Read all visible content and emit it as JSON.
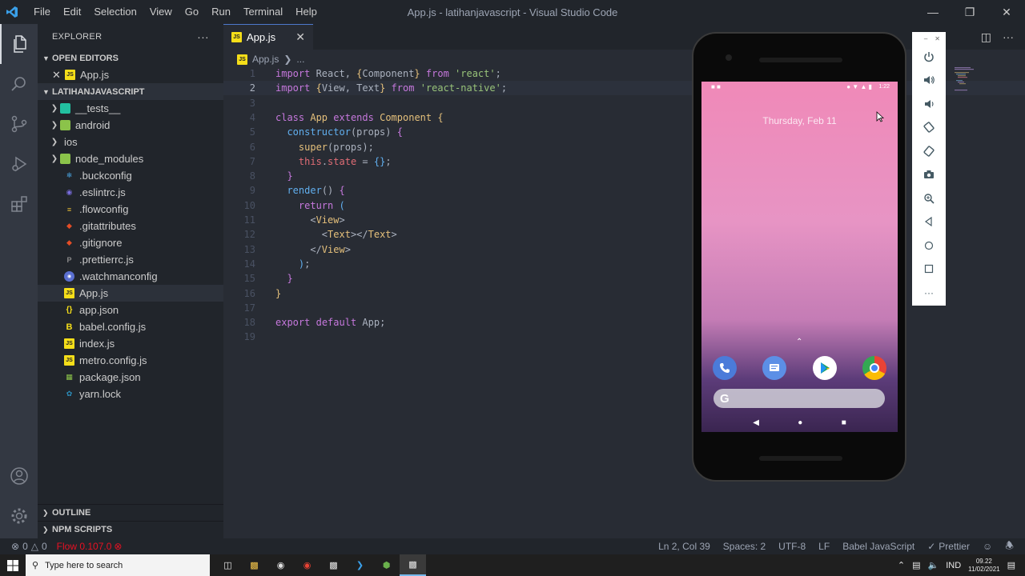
{
  "window": {
    "title": "App.js - latihanjavascript - Visual Studio Code",
    "menu": [
      "File",
      "Edit",
      "Selection",
      "View",
      "Go",
      "Run",
      "Terminal",
      "Help"
    ]
  },
  "sidebar": {
    "explorer_label": "EXPLORER",
    "open_editors_label": "OPEN EDITORS",
    "open_editor_item": "App.js",
    "project_label": "LATIHANJAVASCRIPT",
    "folders": [
      "__tests__",
      "android",
      "ios",
      "node_modules"
    ],
    "files": [
      ".buckconfig",
      ".eslintrc.js",
      ".flowconfig",
      ".gitattributes",
      ".gitignore",
      ".prettierrc.js",
      ".watchmanconfig",
      "App.js",
      "app.json",
      "babel.config.js",
      "index.js",
      "metro.config.js",
      "package.json",
      "yarn.lock"
    ],
    "outline_label": "OUTLINE",
    "npm_label": "NPM SCRIPTS"
  },
  "tab": {
    "label": "App.js",
    "js_badge": "JS"
  },
  "breadcrumb": {
    "file": "App.js",
    "more": "..."
  },
  "editor": {
    "line_numbers": [
      "1",
      "2",
      "3",
      "4",
      "5",
      "6",
      "7",
      "8",
      "9",
      "10",
      "11",
      "12",
      "13",
      "14",
      "15",
      "16",
      "17",
      "18",
      "19"
    ],
    "current_line": 2
  },
  "statusbar": {
    "errors": "0",
    "warnings": "0",
    "flow": "Flow 0.107.0",
    "position": "Ln 2, Col 39",
    "spaces": "Spaces: 2",
    "encoding": "UTF-8",
    "eol": "LF",
    "language": "Babel JavaScript",
    "prettier": "Prettier"
  },
  "taskbar": {
    "search_placeholder": "Type here to search",
    "lang": "IND",
    "time": "09.22",
    "date": "11/02/2021"
  },
  "emulator": {
    "status_time": "1:22",
    "date_text": "Thursday, Feb 11"
  },
  "colors": {
    "accent": "#4d78cc",
    "error": "#e81123",
    "js_icon": "#f5de19"
  }
}
